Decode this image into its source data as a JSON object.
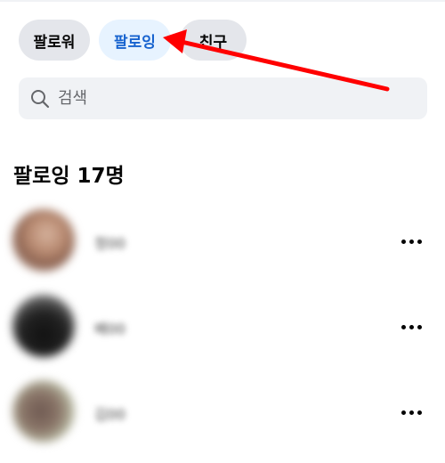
{
  "tabs": [
    {
      "label": "팔로워",
      "active": false
    },
    {
      "label": "팔로잉",
      "active": true
    },
    {
      "label": "친구",
      "active": false
    }
  ],
  "search": {
    "placeholder": "검색",
    "value": "",
    "icon": "search-icon"
  },
  "section": {
    "title": "팔로잉 17명"
  },
  "people": [
    {
      "name": "정00",
      "avatar": "avatar-1"
    },
    {
      "name": "배00",
      "avatar": "avatar-2"
    },
    {
      "name": "김00",
      "avatar": "avatar-3"
    }
  ],
  "more_icon": "more-horizontal-icon",
  "colors": {
    "active_tab_bg": "#e7f3ff",
    "active_tab_text": "#1763cf",
    "inactive_tab_bg": "#e4e6eb",
    "annotation_arrow": "#ff0000"
  }
}
